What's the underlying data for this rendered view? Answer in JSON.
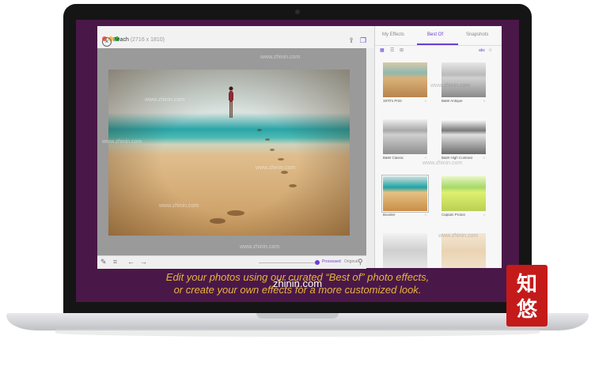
{
  "window": {
    "title": "Beach",
    "dimensions": "(2716 x 1810)"
  },
  "panel": {
    "tabs": [
      "My Effects",
      "Best Of",
      "Snapshots"
    ],
    "active_tab": "Best Of",
    "sort_label": "abc",
    "effects": [
      {
        "label": "1970's Print",
        "style": "warm"
      },
      {
        "label": "B&W Antique",
        "style": "bw"
      },
      {
        "label": "B&W Classic",
        "style": "bw"
      },
      {
        "label": "B&W High Contrast",
        "style": "bw"
      },
      {
        "label": "Booster",
        "style": "warm",
        "selected": true
      },
      {
        "label": "Captain Proton",
        "style": "green"
      }
    ]
  },
  "bottombar": {
    "processed_label": "Processed",
    "original_label": "Original"
  },
  "promo": {
    "line1": "Edit your photos using our curated “Best of” photo effects,",
    "line2": "or create your own effects for a more customized look.",
    "site": "zhinin.com"
  },
  "watermark": "www.zhinin.com",
  "colors": {
    "accent": "#6a3fd8",
    "screen_bg": "#4a1848",
    "caption": "#e6b43c",
    "logo": "#c41a1a"
  },
  "icons": [
    "close-icon",
    "share-icon",
    "copy-icon",
    "edit-icon",
    "crop-icon",
    "undo-icon",
    "redo-icon",
    "search-icon",
    "grid-icon",
    "list-icon",
    "star-icon"
  ]
}
